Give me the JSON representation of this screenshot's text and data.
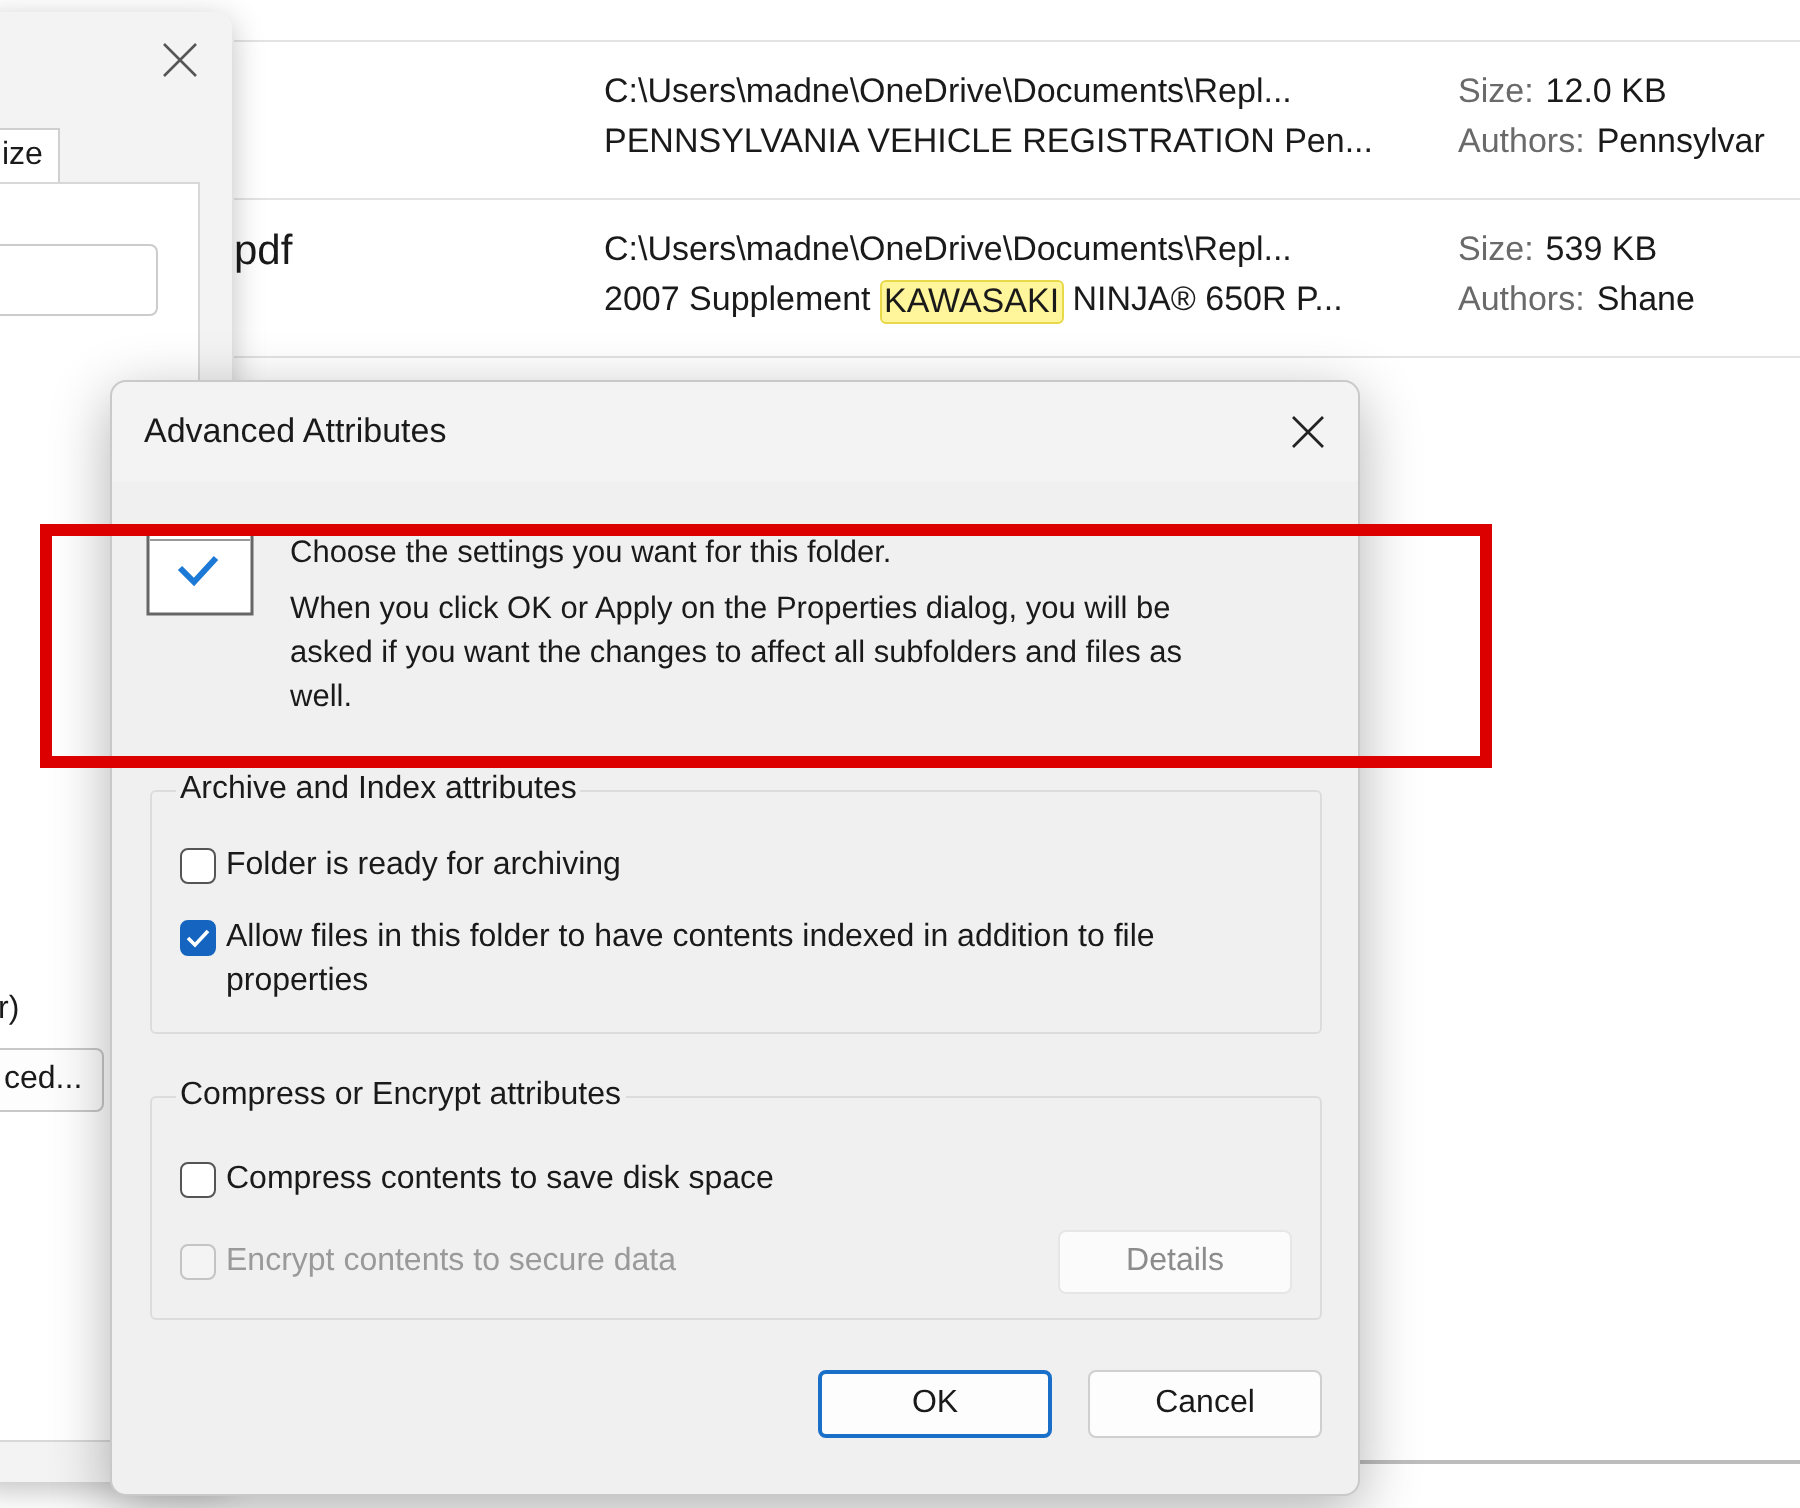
{
  "search_results": [
    {
      "path": "C:\\Users\\madne\\OneDrive\\Documents\\Repl...",
      "title_parts": [
        {
          "text": "PENNSYLVANIA VEHICLE REGISTRATION Pen...",
          "highlighted": false
        }
      ],
      "size_label": "Size:",
      "size": "12.0 KB",
      "authors_label": "Authors:",
      "authors": "Pennsylvar"
    },
    {
      "filename": "pdf",
      "path": "C:\\Users\\madne\\OneDrive\\Documents\\Repl...",
      "title_parts": [
        {
          "text": "2007 Supplement ",
          "highlighted": false
        },
        {
          "text": "KAWASAKI",
          "highlighted": true
        },
        {
          "text": " NINJA® 650R P...",
          "highlighted": false
        }
      ],
      "size_label": "Size:",
      "size": "539 KB",
      "authors_label": "Authors:",
      "authors": "Shane"
    }
  ],
  "properties_window": {
    "tab_label": "ize",
    "option_text": "r)",
    "button_label": "ced..."
  },
  "dialog": {
    "title": "Advanced Attributes",
    "heading": "Choose the settings you want for this folder.",
    "description": "When you click OK or Apply on the Properties dialog, you will be asked if you want the changes to affect all subfolders and files as well.",
    "groups": [
      {
        "legend": "Archive and Index attributes",
        "options": [
          {
            "label": "Folder is ready for archiving",
            "checked": false,
            "disabled": false
          },
          {
            "label": "Allow files in this folder to have contents indexed in addition to file properties",
            "checked": true,
            "disabled": false
          }
        ]
      },
      {
        "legend": "Compress or Encrypt attributes",
        "options": [
          {
            "label": "Compress contents to save disk space",
            "checked": false,
            "disabled": false
          },
          {
            "label": "Encrypt contents to secure data",
            "checked": false,
            "disabled": true
          }
        ],
        "button": {
          "label": "Details",
          "disabled": true
        }
      }
    ],
    "buttons": [
      {
        "label": "OK",
        "default": true
      },
      {
        "label": "Cancel",
        "default": false
      }
    ]
  },
  "annotations": [
    {
      "kind": "rectangle"
    }
  ]
}
